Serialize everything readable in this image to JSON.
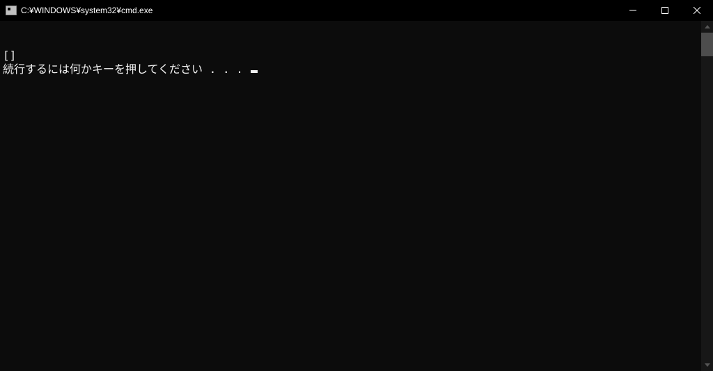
{
  "titlebar": {
    "title": "C:¥WINDOWS¥system32¥cmd.exe"
  },
  "console": {
    "line1": "[]",
    "line2": "続行するには何かキーを押してください . . . "
  }
}
